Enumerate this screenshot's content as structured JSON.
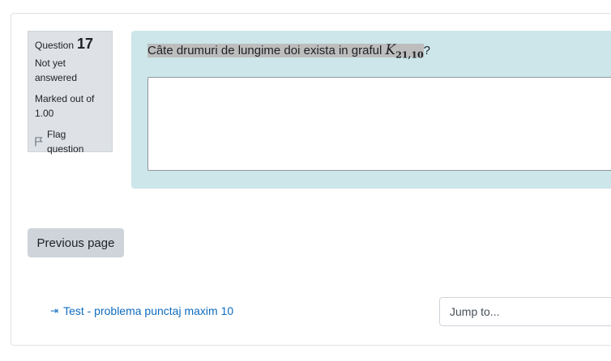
{
  "question_info": {
    "label": "Question",
    "number": "17",
    "state": "Not yet answered",
    "grade": "Marked out of 1.00",
    "flag_label": "Flag question"
  },
  "question": {
    "text": "Câte drumuri de lungime doi exista in graful",
    "math_symbol": "K",
    "math_subscript": "21,10",
    "suffix": "?",
    "answer_value": ""
  },
  "navigation": {
    "previous_label": "Previous page",
    "quiz_link_arrow": "⇥",
    "quiz_link_label": "Test - problema punctaj maxim 10",
    "jump_placeholder": "Jump to..."
  },
  "colors": {
    "content_bg": "#cce6ea",
    "info_bg": "#dee2e6",
    "link": "#0f6cbf",
    "button_bg": "#ced4da"
  }
}
